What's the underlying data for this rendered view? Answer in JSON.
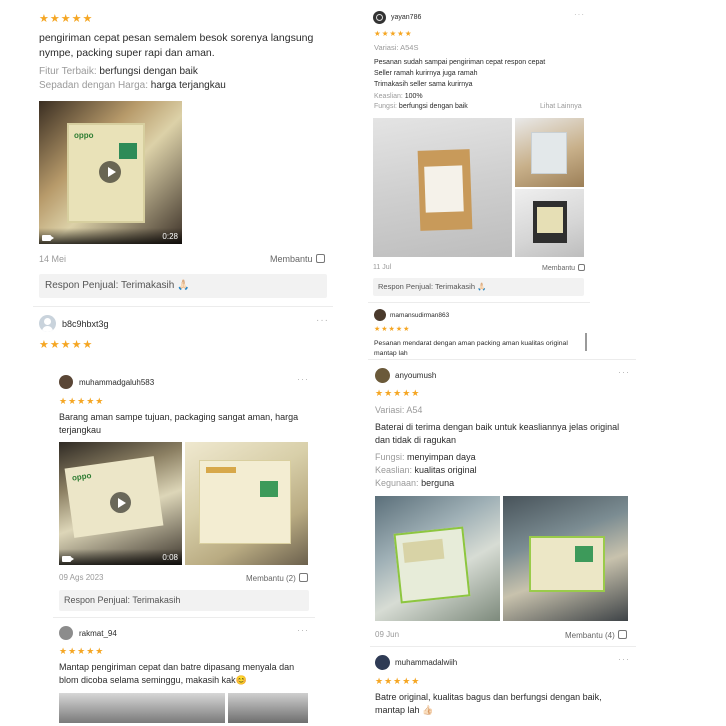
{
  "left": {
    "review1": {
      "stars": "★★★★★",
      "text": "pengiriman cepat pesan semalem besok sorenya langsung nympe, packing super rapi dan aman.",
      "attr1_label": "Fitur Terbaik:",
      "attr1_value": "berfungsi dengan baik",
      "attr2_label": "Sepadan dengan Harga:",
      "attr2_value": "harga terjangkau",
      "video_duration": "0:28",
      "date": "14 Mei",
      "helpful": "Membantu",
      "seller_response": "Respon Penjual: Terimakasih 🙏🏻"
    },
    "review2": {
      "username": "b8c9hbxt3g",
      "stars": "★★★★★",
      "more": "···"
    },
    "review3": {
      "username": "muhammadgaluh583",
      "more": "···",
      "stars": "★★★★★",
      "text": "Barang aman sampe tujuan, packaging sangat aman, harga terjangkau",
      "video_duration": "0:08",
      "date": "09 Ags 2023",
      "helpful": "Membantu (2)",
      "seller_response": "Respon Penjual: Terimakasih"
    },
    "review4": {
      "username": "rakmat_94",
      "more": "···",
      "stars": "★★★★★",
      "text": "Mantap pengiriman cepat dan batre dipasang menyala dan blom dicoba selama seminggu, makasih kak😊"
    }
  },
  "right": {
    "review1": {
      "username": "yayan786",
      "more": "···",
      "stars": "★★★★★",
      "variant": "Variasi: A54S",
      "text_line1": "Pesanan sudah sampai pengiriman cepat respon cepat",
      "text_line2": "Seller ramah kurirnya juga ramah",
      "text_line3": "Trimakasih seller sama kurirnya",
      "attr1_label": "Keaslian:",
      "attr1_value": "100%",
      "attr2_label": "Fungsi:",
      "attr2_value": "berfungsi dengan baik",
      "see_more": "Lihat Lainnya",
      "date": "11 Jul",
      "helpful": "Membantu",
      "seller_response": "Respon Penjual: Terimakasih 🙏🏻"
    },
    "review2": {
      "username": "mamansudirman863",
      "stars": "★★★★★",
      "text": "Pesanan mendarat dengan aman packing aman  kualitas original mantap lah"
    },
    "review3": {
      "username": "anyoumush",
      "more": "···",
      "stars": "★★★★★",
      "variant": "Variasi: A54",
      "text": "Baterai di terima dengan baik untuk keasliannya jelas original dan tidak di ragukan",
      "attr1_label": "Fungsi:",
      "attr1_value": "menyimpan daya",
      "attr2_label": "Keaslian:",
      "attr2_value": "kualitas original",
      "attr3_label": "Kegunaan:",
      "attr3_value": "berguna",
      "date": "09 Jun",
      "helpful": "Membantu (4)"
    },
    "review4": {
      "username": "muhammadalwiih",
      "more": "···",
      "stars": "★★★★★",
      "text": "Batre original, kualitas bagus dan berfungsi dengan baik, mantap lah 👍🏻"
    }
  },
  "colors": {
    "star": "#f5a623",
    "response_bg": "#f2f2f2",
    "gray_text": "#9a9a9a"
  }
}
